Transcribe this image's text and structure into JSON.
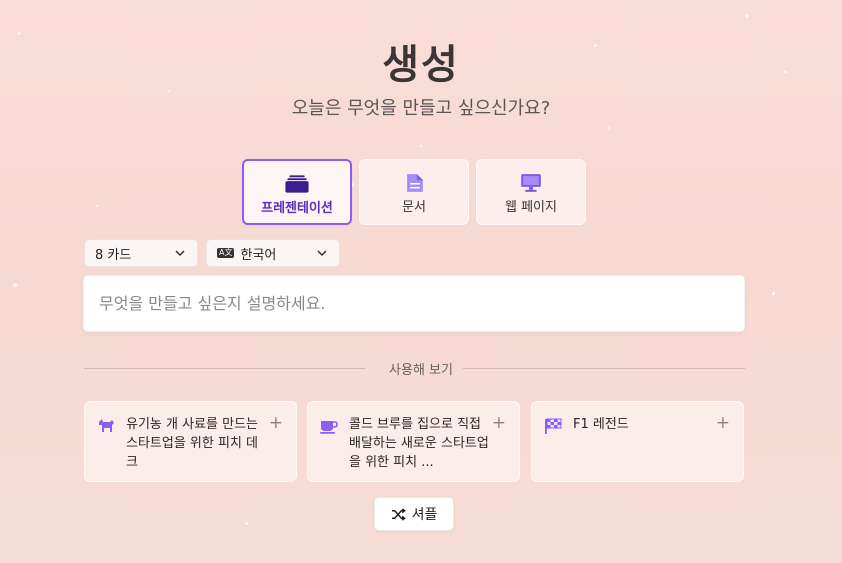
{
  "header": {
    "title": "생성",
    "subtitle": "오늘은 무엇을 만들고 싶으신가요?"
  },
  "type_tabs": [
    {
      "label": "프레젠테이션",
      "icon": "presentation-stack-icon",
      "selected": true
    },
    {
      "label": "문서",
      "icon": "document-icon",
      "selected": false
    },
    {
      "label": "웹 페이지",
      "icon": "monitor-icon",
      "selected": false
    }
  ],
  "options": {
    "cards_select": "8 카드",
    "language_badge": "A文",
    "language_select": "한국어"
  },
  "prompt": {
    "placeholder": "무엇을 만들고 싶은지 설명하세요."
  },
  "examples": {
    "section_label": "사용해 보기",
    "items": [
      {
        "text": "유기농 개 사료를 만드는 스타트업을 위한 피치 데크",
        "icon": "dog-icon"
      },
      {
        "text": "콜드 브루를 집으로 직접 배달하는 새로운 스타트업을 위한 피치 ...",
        "icon": "coffee-cup-icon"
      },
      {
        "text": "F1 레전드",
        "icon": "checkered-flag-icon"
      }
    ],
    "add_symbol": "+"
  },
  "shuffle": {
    "label": "셔플",
    "icon": "shuffle-icon"
  },
  "colors": {
    "accent": "#8b5cf6",
    "accent_dark": "#5b2bc2",
    "background": "#f8dbd6"
  }
}
